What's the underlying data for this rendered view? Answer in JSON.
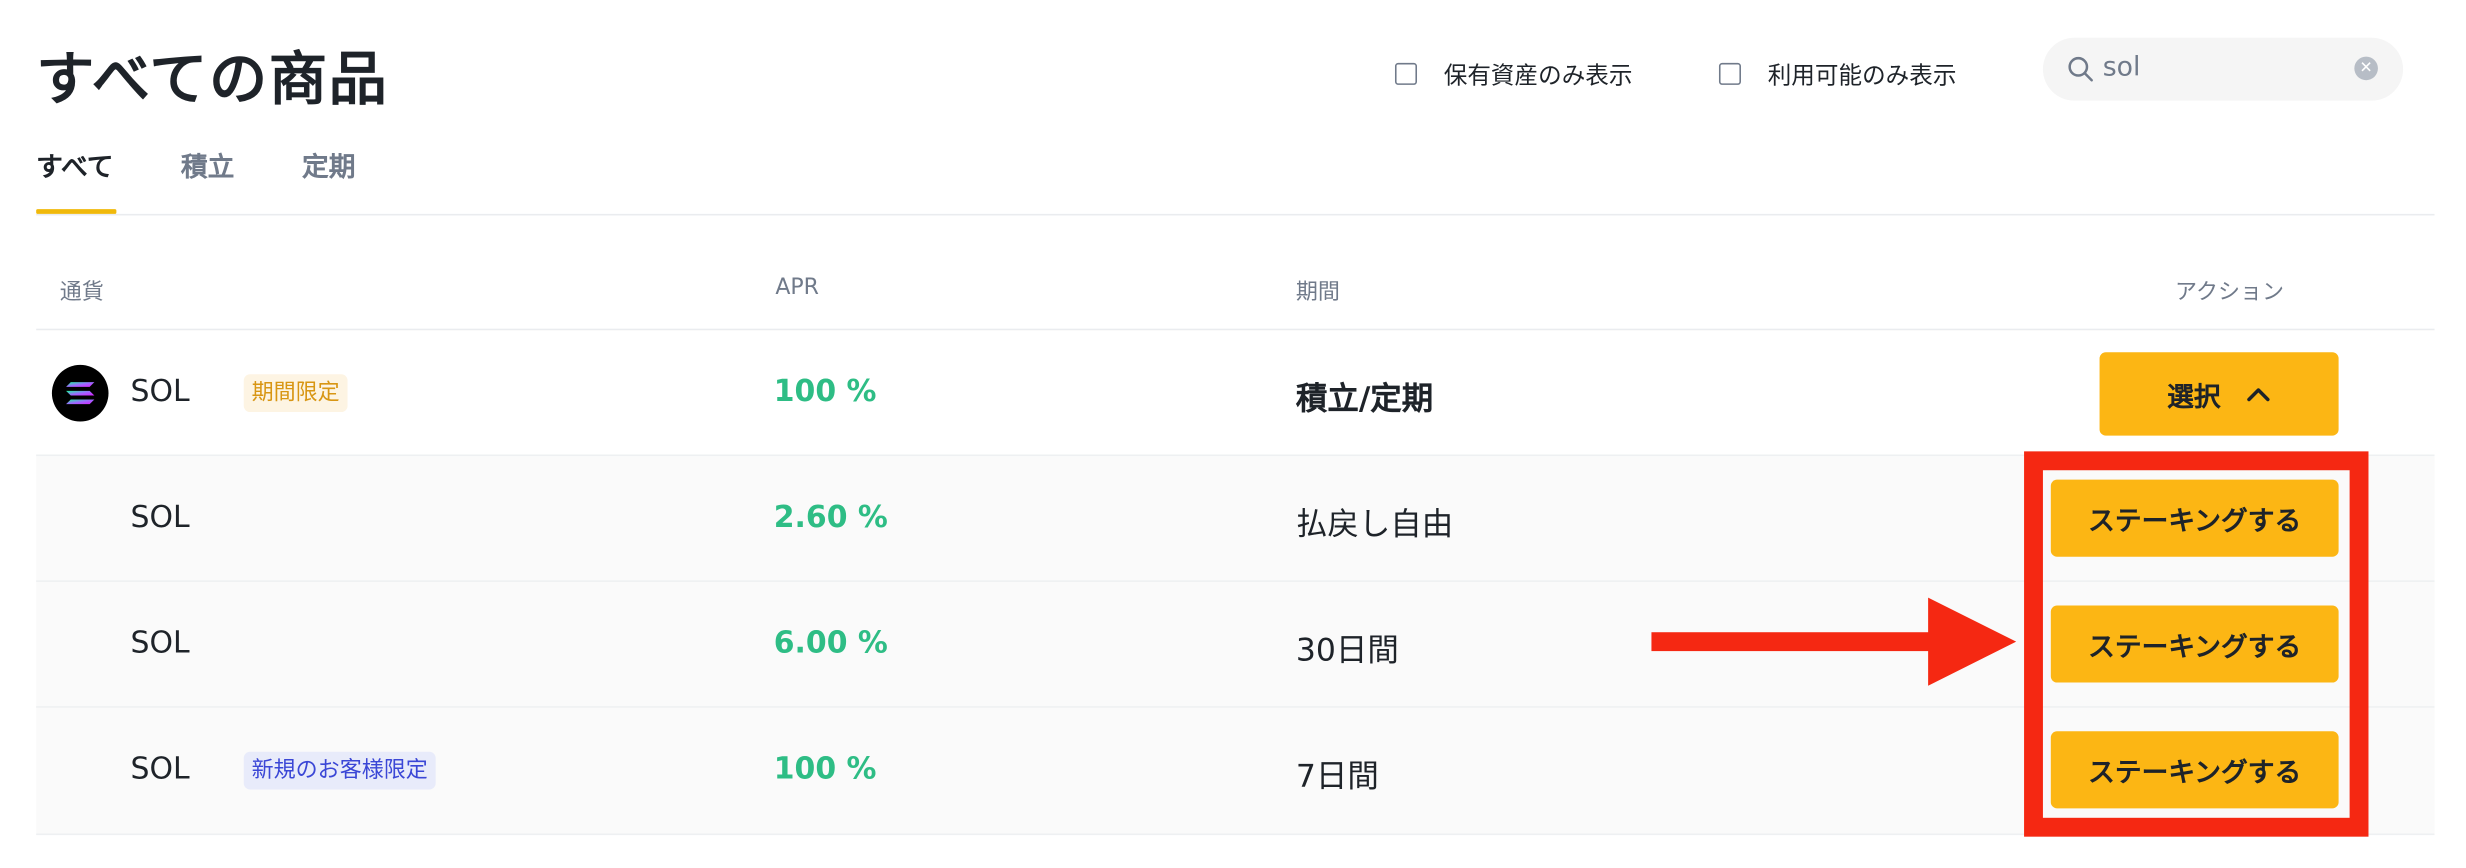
{
  "page_title": "すべての商品",
  "filters": {
    "held_only": "保有資産のみ表示",
    "available_only": "利用可能のみ表示"
  },
  "search": {
    "value": "sol",
    "icon": "search-icon"
  },
  "tabs": [
    {
      "label": "すべて",
      "active": true
    },
    {
      "label": "積立",
      "active": false
    },
    {
      "label": "定期",
      "active": false
    }
  ],
  "table": {
    "headers": {
      "currency": "通貨",
      "apr": "APR",
      "period": "期間",
      "action": "アクション"
    },
    "group": {
      "coin": "SOL",
      "badge": "期間限定",
      "apr": "100 %",
      "period": "積立/定期",
      "action_label": "選択"
    },
    "rows": [
      {
        "coin": "SOL",
        "badge": "",
        "apr": "2.60 %",
        "period": "払戻し自由",
        "action_label": "ステーキングする"
      },
      {
        "coin": "SOL",
        "badge": "",
        "apr": "6.00 %",
        "period": "30日間",
        "action_label": "ステーキングする"
      },
      {
        "coin": "SOL",
        "badge": "新規のお客様限定",
        "apr": "100 %",
        "period": "7日間",
        "action_label": "ステーキングする"
      }
    ]
  },
  "colors": {
    "accent": "#fcb614",
    "positive": "#2ebd85",
    "annotation": "#f52812"
  }
}
